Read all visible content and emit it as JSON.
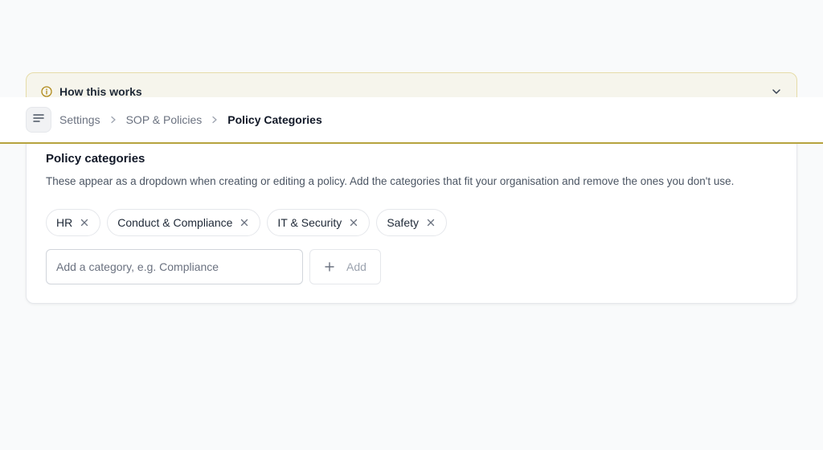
{
  "info_panel": {
    "title": "How this works",
    "accent_color": "#b08a1a"
  },
  "header": {
    "menu_icon": "menu-lines-icon",
    "breadcrumb": [
      "Settings",
      "SOP & Policies",
      "Policy Categories"
    ],
    "separator_icon": "chevron-right-icon",
    "accent_border": "#b6a33e"
  },
  "card": {
    "title": "Policy categories",
    "description": "These appear as a dropdown when creating or editing a policy. Add the categories that fit your organisation and remove the ones you don't use.",
    "categories": [
      "HR",
      "Conduct & Compliance",
      "IT & Security",
      "Safety"
    ],
    "remove_icon": "close-icon",
    "input": {
      "value": "",
      "placeholder": "Add a category, e.g. Compliance"
    },
    "add_button": {
      "label": "Add",
      "icon": "plus-icon"
    }
  }
}
